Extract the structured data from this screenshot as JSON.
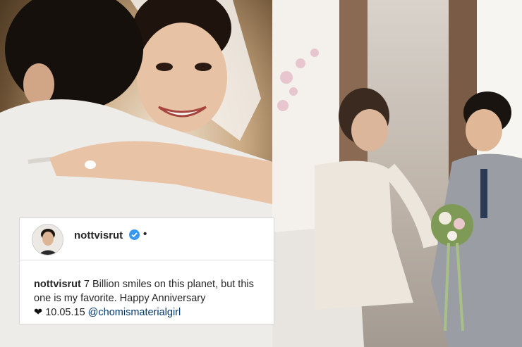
{
  "post": {
    "username": "nottvisrut",
    "separator": "•",
    "caption_text": "7 Billion smiles on this planet, but this one is my favorite. Happy Anniversary",
    "heart_glyph": "❤",
    "date_text": "10.05.15",
    "mention": "@chomismaterialgirl"
  },
  "colors": {
    "verified_badge": "#3897f0",
    "mention": "#00376b"
  },
  "icons": {
    "verified": "verified-badge-icon",
    "heart": "heart-icon"
  }
}
